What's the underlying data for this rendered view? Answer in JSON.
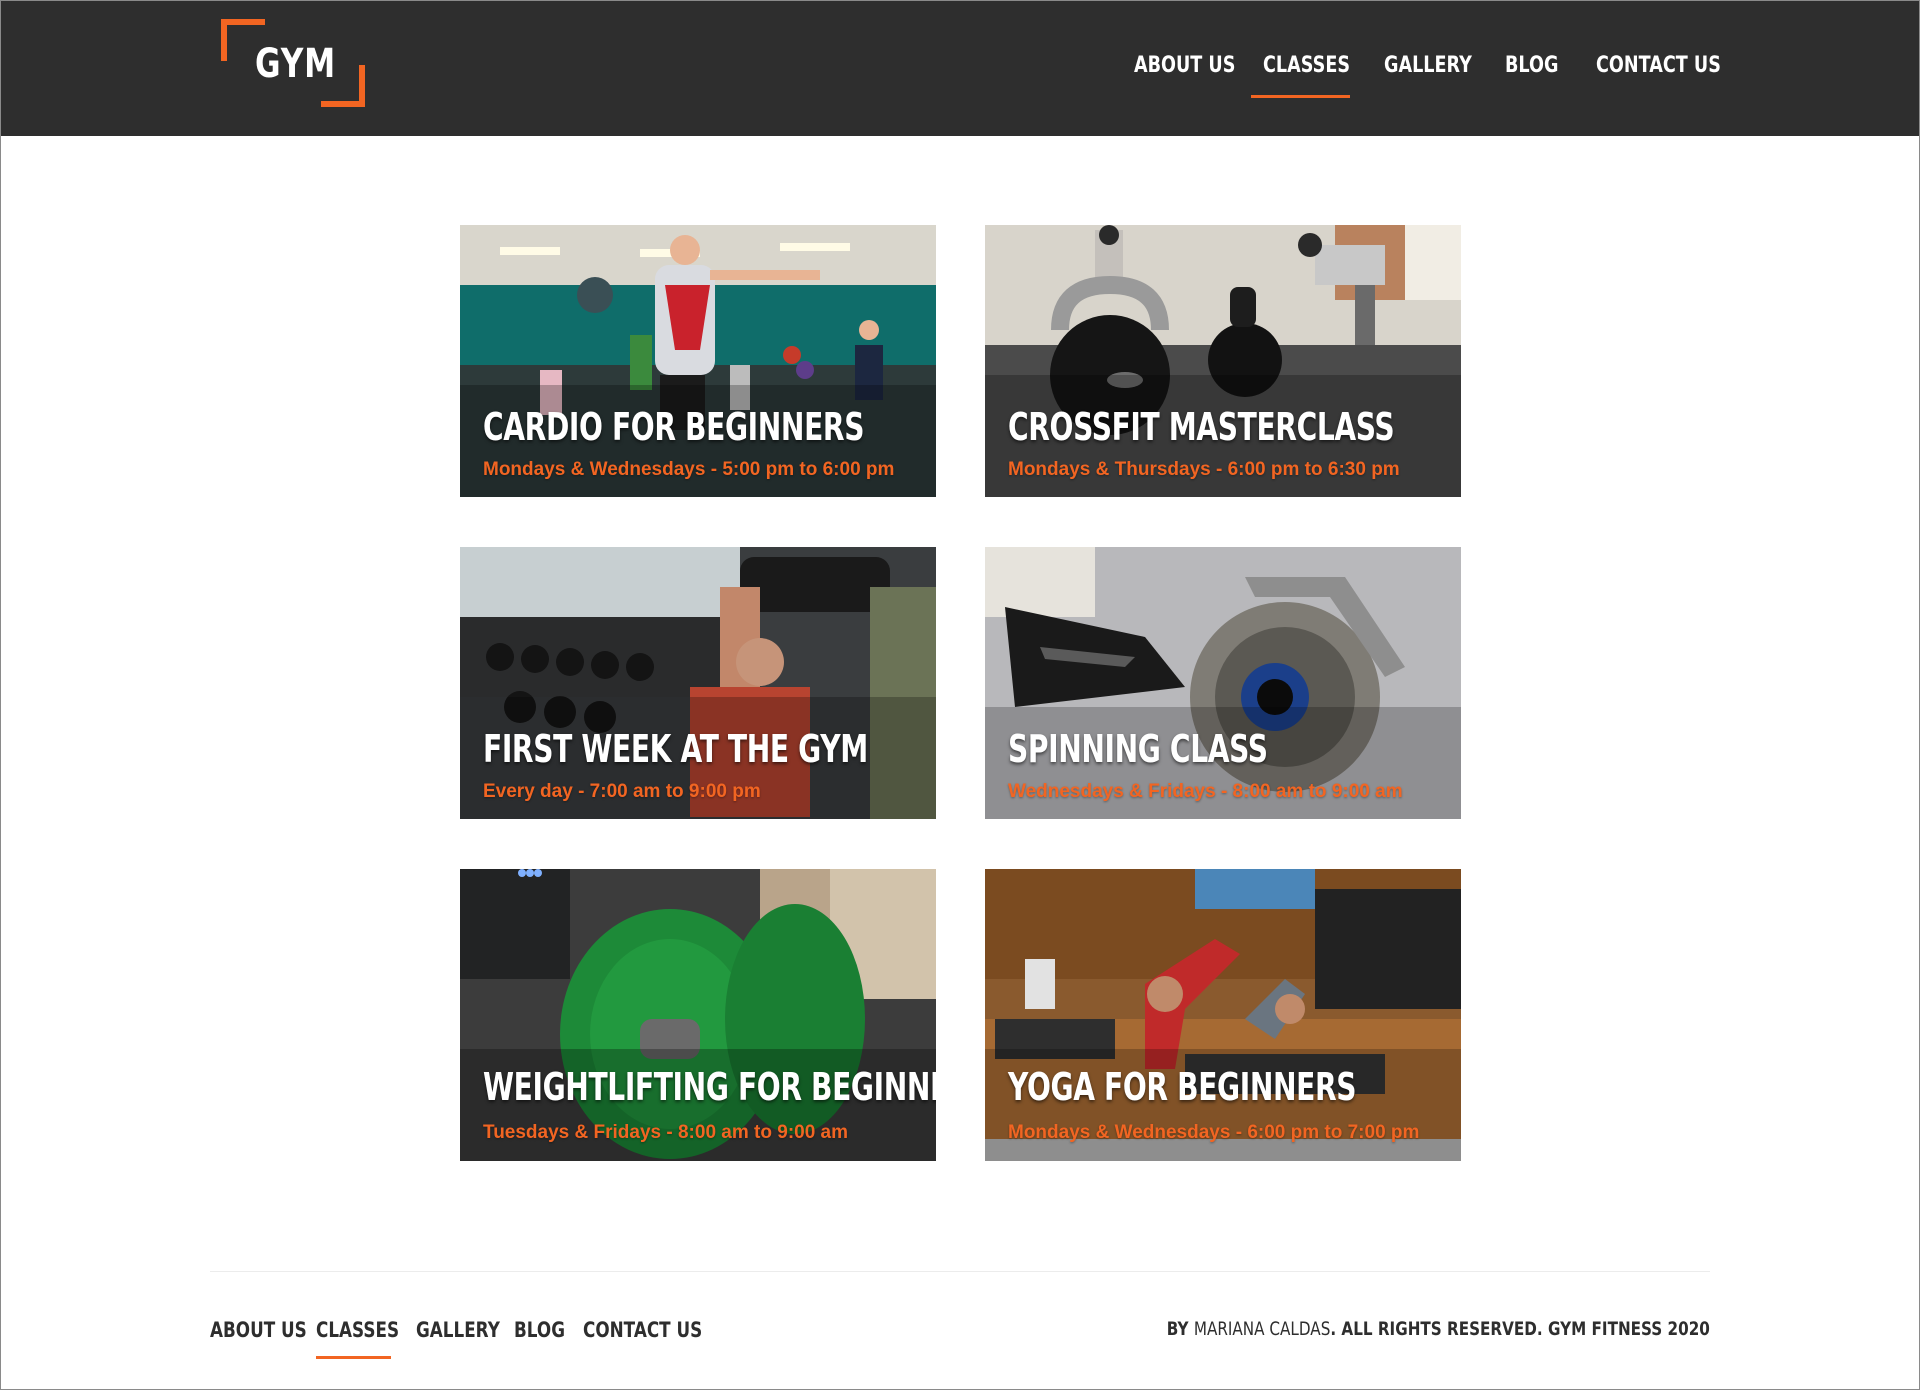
{
  "brand": {
    "logo_text": "GYM",
    "accent_color": "#f26522",
    "header_bg": "#2e2e2e"
  },
  "nav": {
    "items": [
      {
        "label": "ABOUT US"
      },
      {
        "label": "CLASSES",
        "active": true
      },
      {
        "label": "GALLERY"
      },
      {
        "label": "BLOG"
      },
      {
        "label": "CONTACT US"
      }
    ]
  },
  "classes": [
    {
      "title": "CARDIO FOR BEGINNERS",
      "schedule": "Mondays & Wednesdays - 5:00 pm to 6:00 pm"
    },
    {
      "title": "CROSSFIT MASTERCLASS",
      "schedule": "Mondays & Thursdays - 6:00 pm to 6:30 pm"
    },
    {
      "title": "FIRST WEEK AT THE GYM",
      "schedule": "Every day - 7:00 am to 9:00 pm"
    },
    {
      "title": "SPINNING CLASS",
      "schedule": "Wednesdays & Fridays - 8:00 am to 9:00 am"
    },
    {
      "title": "WEIGHTLIFTING FOR BEGINNERS",
      "schedule": "Tuesdays & Fridays - 8:00 am to 9:00 am"
    },
    {
      "title": "YOGA FOR BEGINNERS",
      "schedule": "Mondays & Wednesdays - 6:00 pm to 7:00 pm"
    }
  ],
  "footer": {
    "nav": [
      {
        "label": "ABOUT US"
      },
      {
        "label": "CLASSES",
        "active": true
      },
      {
        "label": "GALLERY"
      },
      {
        "label": "BLOG"
      },
      {
        "label": "CONTACT US"
      }
    ],
    "credit_prefix": "BY",
    "credit_author": "MARIANA CALDAS",
    "credit_suffix": ". ALL RIGHTS RESERVED. GYM FITNESS 2020"
  }
}
